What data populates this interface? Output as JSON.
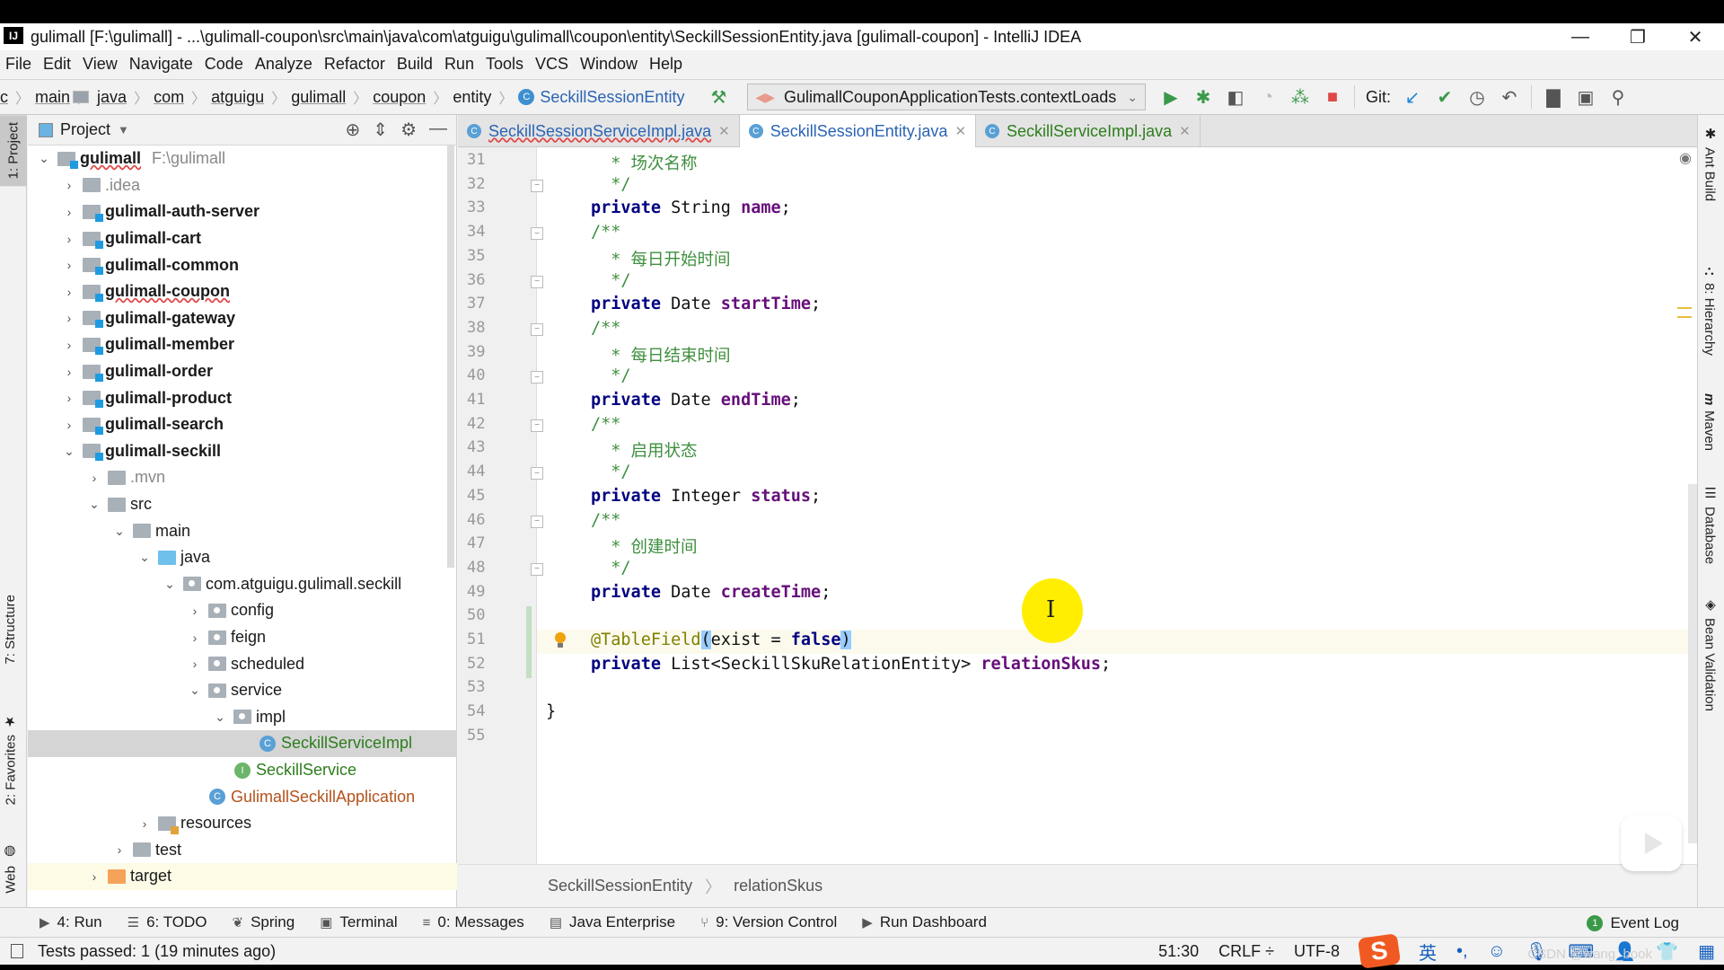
{
  "window": {
    "title": "gulimall [F:\\gulimall] - ...\\gulimall-coupon\\src\\main\\java\\com\\atguigu\\gulimall\\coupon\\entity\\SeckillSessionEntity.java [gulimall-coupon] - IntelliJ IDEA",
    "logo": "IJ",
    "controls": {
      "minimize": "—",
      "restore": "❐",
      "close": "✕"
    }
  },
  "menu": [
    "File",
    "Edit",
    "View",
    "Navigate",
    "Code",
    "Analyze",
    "Refactor",
    "Build",
    "Run",
    "Tools",
    "VCS",
    "Window",
    "Help"
  ],
  "navbar": {
    "crumbs": [
      "c",
      "main",
      "java",
      "com",
      "atguigu",
      "gulimall",
      "coupon",
      "entity",
      "SeckillSessionEntity"
    ],
    "run_config": "GulimallCouponApplicationTests.contextLoads",
    "git_label": "Git:"
  },
  "left_stripe": {
    "project": "1: Project",
    "structure": "7: Structure",
    "favorites": "2: Favorites",
    "web": "Web"
  },
  "project": {
    "header": "Project",
    "tree": [
      {
        "label": "gulimall",
        "hint": "F:\\gulimall",
        "depth": 0,
        "arrow": "open",
        "icon": "mod",
        "style": "bold"
      },
      {
        "label": ".idea",
        "depth": 1,
        "arrow": "closed",
        "icon": "folder",
        "style": "gray"
      },
      {
        "label": "gulimall-auth-server",
        "depth": 1,
        "arrow": "closed",
        "icon": "mod",
        "style": "bold"
      },
      {
        "label": "gulimall-cart",
        "depth": 1,
        "arrow": "closed",
        "icon": "mod",
        "style": "bold"
      },
      {
        "label": "gulimall-common",
        "depth": 1,
        "arrow": "closed",
        "icon": "mod",
        "style": "bold"
      },
      {
        "label": "gulimall-coupon",
        "depth": 1,
        "arrow": "closed",
        "icon": "mod",
        "style": "bold"
      },
      {
        "label": "gulimall-gateway",
        "depth": 1,
        "arrow": "closed",
        "icon": "mod",
        "style": "bold"
      },
      {
        "label": "gulimall-member",
        "depth": 1,
        "arrow": "closed",
        "icon": "mod",
        "style": "bold"
      },
      {
        "label": "gulimall-order",
        "depth": 1,
        "arrow": "closed",
        "icon": "mod",
        "style": "bold"
      },
      {
        "label": "gulimall-product",
        "depth": 1,
        "arrow": "closed",
        "icon": "mod",
        "style": "bold"
      },
      {
        "label": "gulimall-search",
        "depth": 1,
        "arrow": "closed",
        "icon": "mod",
        "style": "bold"
      },
      {
        "label": "gulimall-seckill",
        "depth": 1,
        "arrow": "open",
        "icon": "mod",
        "style": "bold"
      },
      {
        "label": ".mvn",
        "depth": 2,
        "arrow": "closed",
        "icon": "folder",
        "style": "gray"
      },
      {
        "label": "src",
        "depth": 2,
        "arrow": "open",
        "icon": "folder",
        "style": ""
      },
      {
        "label": "main",
        "depth": 3,
        "arrow": "open",
        "icon": "folder",
        "style": ""
      },
      {
        "label": "java",
        "depth": 4,
        "arrow": "open",
        "icon": "src",
        "style": ""
      },
      {
        "label": "com.atguigu.gulimall.seckill",
        "depth": 5,
        "arrow": "open",
        "icon": "pkg",
        "style": ""
      },
      {
        "label": "config",
        "depth": 6,
        "arrow": "closed",
        "icon": "pkg",
        "style": ""
      },
      {
        "label": "feign",
        "depth": 6,
        "arrow": "closed",
        "icon": "pkg",
        "style": ""
      },
      {
        "label": "scheduled",
        "depth": 6,
        "arrow": "closed",
        "icon": "pkg",
        "style": ""
      },
      {
        "label": "service",
        "depth": 6,
        "arrow": "open",
        "icon": "pkg",
        "style": ""
      },
      {
        "label": "impl",
        "depth": 7,
        "arrow": "open",
        "icon": "pkg",
        "style": ""
      },
      {
        "label": "SeckillServiceImpl",
        "depth": 8,
        "arrow": "none",
        "icon": "class",
        "style": "green",
        "selected": true
      },
      {
        "label": "SeckillService",
        "depth": 7,
        "arrow": "none",
        "icon": "interface",
        "style": "green"
      },
      {
        "label": "GulimallSeckillApplication",
        "depth": 6,
        "arrow": "none",
        "icon": "app",
        "style": "brown"
      },
      {
        "label": "resources",
        "depth": 4,
        "arrow": "closed",
        "icon": "res",
        "style": ""
      },
      {
        "label": "test",
        "depth": 3,
        "arrow": "closed",
        "icon": "folder",
        "style": ""
      },
      {
        "label": "target",
        "depth": 2,
        "arrow": "closed",
        "icon": "tgt",
        "style": "",
        "target": true
      }
    ]
  },
  "tabs": [
    {
      "label": "SeckillSessionServiceImpl.java",
      "active": false,
      "color": "#2a64b4",
      "error": true
    },
    {
      "label": "SeckillSessionEntity.java",
      "active": true,
      "color": "#2a64b4"
    },
    {
      "label": "SeckillServiceImpl.java",
      "active": false,
      "color": "#2d7d1c"
    }
  ],
  "editor": {
    "lines": [
      {
        "n": "31",
        "html": "  <span class='cmt'>* 场次名称</span>"
      },
      {
        "n": "32",
        "html": "  <span class='cmt'>*/</span>",
        "fold": true
      },
      {
        "n": "33",
        "html": "<span class='kw'>private</span> String <span class='fld'>name</span>;"
      },
      {
        "n": "34",
        "html": "<span class='cmt'>/**</span>",
        "fold": true
      },
      {
        "n": "35",
        "html": "  <span class='cmt'>* 每日开始时间</span>"
      },
      {
        "n": "36",
        "html": "  <span class='cmt'>*/</span>",
        "fold": true
      },
      {
        "n": "37",
        "html": "<span class='kw'>private</span> Date <span class='fld'>startTime</span>;"
      },
      {
        "n": "38",
        "html": "<span class='cmt'>/**</span>",
        "fold": true
      },
      {
        "n": "39",
        "html": "  <span class='cmt'>* 每日结束时间</span>"
      },
      {
        "n": "40",
        "html": "  <span class='cmt'>*/</span>",
        "fold": true
      },
      {
        "n": "41",
        "html": "<span class='kw'>private</span> Date <span class='fld'>endTime</span>;"
      },
      {
        "n": "42",
        "html": "<span class='cmt'>/**</span>",
        "fold": true
      },
      {
        "n": "43",
        "html": "  <span class='cmt'>* 启用状态</span>"
      },
      {
        "n": "44",
        "html": "  <span class='cmt'>*/</span>",
        "fold": true
      },
      {
        "n": "45",
        "html": "<span class='kw'>private</span> Integer <span class='fld'>status</span>;"
      },
      {
        "n": "46",
        "html": "<span class='cmt'>/**</span>",
        "fold": true
      },
      {
        "n": "47",
        "html": "  <span class='cmt'>* 创建时间</span>"
      },
      {
        "n": "48",
        "html": "  <span class='cmt'>*/</span>",
        "fold": true
      },
      {
        "n": "49",
        "html": "<span class='kw'>private</span> Date <span class='fld'>createTime</span>;"
      },
      {
        "n": "50",
        "html": ""
      },
      {
        "n": "51",
        "html": "<span class='ann'>@TableField</span><span class='paren'>(</span>exist = <span class='kw'>false</span><span class='paren'>)</span>",
        "current": true
      },
      {
        "n": "52",
        "html": "<span class='kw'>private</span> List&lt;SeckillSkuRelationEntity&gt; <span class='fld'>relationSkus</span>;"
      },
      {
        "n": "53",
        "html": ""
      },
      {
        "n": "54",
        "html": "}",
        "outdent": true
      },
      {
        "n": "55",
        "html": ""
      }
    ],
    "breadcrumb": [
      "SeckillSessionEntity",
      "relationSkus"
    ]
  },
  "right_stripe": [
    "Ant Build",
    "8: Hierarchy",
    "Maven",
    "Database",
    "Bean Validation"
  ],
  "bottom_tabs": [
    {
      "icon": "▶",
      "label": "4: Run"
    },
    {
      "icon": "☰",
      "label": "6: TODO"
    },
    {
      "icon": "❦",
      "label": "Spring"
    },
    {
      "icon": "▣",
      "label": "Terminal"
    },
    {
      "icon": "≡",
      "label": "0: Messages"
    },
    {
      "icon": "▤",
      "label": "Java Enterprise"
    },
    {
      "icon": "⑂",
      "label": "9: Version Control"
    },
    {
      "icon": "▶",
      "label": "Run Dashboard"
    }
  ],
  "event_log": {
    "badge": "1",
    "label": "Event Log"
  },
  "status": {
    "message": "Tests passed: 1 (19 minutes ago)",
    "position": "51:30",
    "line_sep": "CRLF ÷",
    "encoding": "UTF-8",
    "ime_lang": "英"
  },
  "watermark": "CSDN @wang_book"
}
